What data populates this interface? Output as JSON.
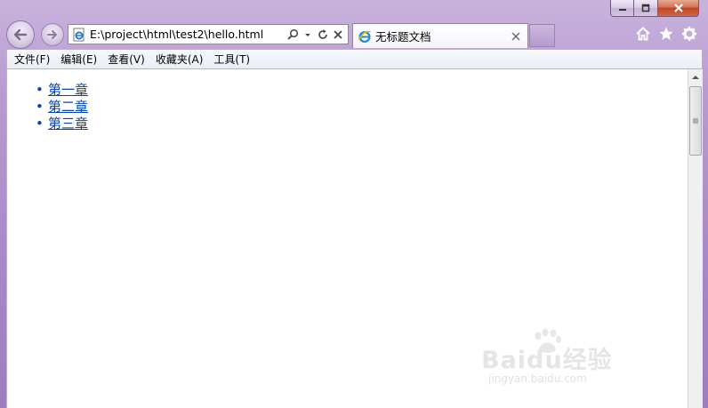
{
  "window": {
    "minimize_icon": "minimize-icon",
    "maximize_icon": "maximize-icon",
    "close_icon": "close-icon"
  },
  "nav": {
    "back_icon": "back-arrow-icon",
    "forward_icon": "forward-arrow-icon"
  },
  "address_bar": {
    "url": "E:\\project\\html\\test2\\hello.html",
    "favicon": "ie-page-icon",
    "search_icon": "search-icon",
    "dropdown_icon": "chevron-down-icon",
    "refresh_icon": "refresh-icon",
    "stop_icon": "stop-icon"
  },
  "tab": {
    "title": "无标题文档",
    "close_symbol": "×"
  },
  "toolbar_icons": [
    "home-icon",
    "favorites-star-icon",
    "gear-icon"
  ],
  "menubar": {
    "items": [
      "文件(F)",
      "编辑(E)",
      "查看(V)",
      "收藏夹(A)",
      "工具(T)"
    ]
  },
  "page": {
    "links": [
      "第一章",
      "第二章",
      "第三章"
    ],
    "bullet": "•"
  },
  "watermark": {
    "logo_text": "Baidu经验",
    "domain": "jingyan.baidu.com"
  },
  "colors": {
    "frame": "#a98ac8",
    "link": "#0645ad",
    "close_button": "#c2441f"
  }
}
